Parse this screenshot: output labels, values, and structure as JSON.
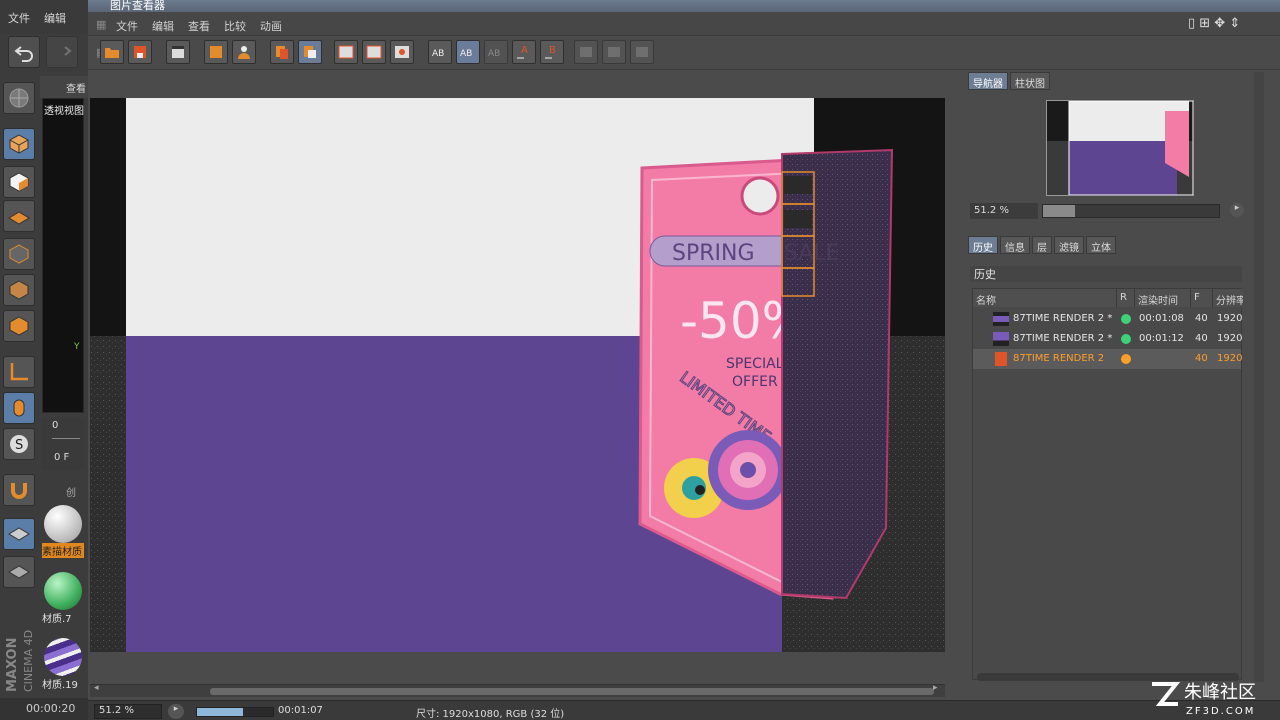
{
  "c4d": {
    "menu": [
      "文件",
      "编辑"
    ],
    "viewport_title": "透视视图",
    "view_tab": "查看",
    "create_tab": "创",
    "frame_values": [
      "0",
      "0 F"
    ],
    "materials": [
      {
        "label": "素描材质",
        "color": "#c9c9c9"
      },
      {
        "label": "材质.7",
        "color": "#3fae5c"
      },
      {
        "label": "材质.19",
        "color": "#6b4fa8"
      }
    ],
    "logo_lines": [
      "MAXON",
      "CINEMA 4D"
    ],
    "bottom_time": "00:00:20"
  },
  "viewer": {
    "title": "图片查看器",
    "menu": [
      "文件",
      "编辑",
      "查看",
      "比较",
      "动画"
    ],
    "render": {
      "tag_text_1": "SPRING",
      "tag_text_2": "SALE",
      "discount": "-50%",
      "special": "SPECIAL",
      "offer": "OFFER",
      "limited": "LIMITED TIME",
      "bg_colors": {
        "top": "#ececec",
        "bottom": "#5d4591",
        "tag": "#f27ca6"
      }
    },
    "status": {
      "zoom": "51.2 %",
      "progress": 0.6,
      "time": "00:01:07",
      "size": "尺寸: 1920x1080, RGB (32 位)"
    }
  },
  "right_panel": {
    "top_tabs": [
      "导航器",
      "柱状图"
    ],
    "nav_zoom": "51.2 %",
    "nav_slider_value": 0.18,
    "lower_tabs": [
      "历史",
      "信息",
      "层",
      "滤镜",
      "立体"
    ],
    "history_title": "历史",
    "columns": [
      "名称",
      "R",
      "渲染时间",
      "F",
      "分辨率"
    ],
    "rows": [
      {
        "name": "87TIME RENDER 2 *",
        "status_color": "#3fd17a",
        "render_time": "00:01:08",
        "frames": "40",
        "res": "1920"
      },
      {
        "name": "87TIME RENDER 2 *",
        "status_color": "#3fd17a",
        "render_time": "00:01:12",
        "frames": "40",
        "res": "1920"
      },
      {
        "name": "87TIME RENDER 2",
        "status_color": "#ff9d2b",
        "render_time": "",
        "frames": "40",
        "res": "1920"
      }
    ]
  },
  "watermark": {
    "brand": "朱峰社区",
    "url": "ZF3D.COM"
  }
}
